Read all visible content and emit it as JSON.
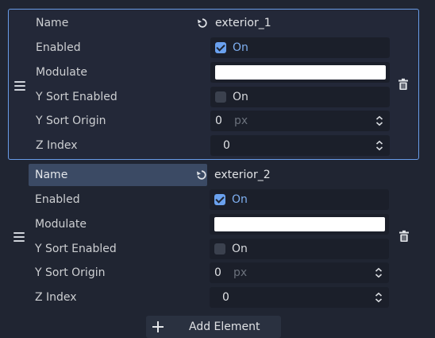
{
  "elements": [
    {
      "name_label": "Name",
      "name_value": "exterior_1",
      "enabled_label": "Enabled",
      "enabled_value": "On",
      "modulate_label": "Modulate",
      "modulate_color": "#ffffff",
      "ysort_enabled_label": "Y Sort Enabled",
      "ysort_enabled_value": "On",
      "ysort_origin_label": "Y Sort Origin",
      "ysort_origin_value": "0",
      "ysort_origin_suffix": "px",
      "zindex_label": "Z Index",
      "zindex_value": "0"
    },
    {
      "name_label": "Name",
      "name_value": "exterior_2",
      "enabled_label": "Enabled",
      "enabled_value": "On",
      "modulate_label": "Modulate",
      "modulate_color": "#ffffff",
      "ysort_enabled_label": "Y Sort Enabled",
      "ysort_enabled_value": "On",
      "ysort_origin_label": "Y Sort Origin",
      "ysort_origin_value": "0",
      "ysort_origin_suffix": "px",
      "zindex_label": "Z Index",
      "zindex_value": "0"
    }
  ],
  "add_button_label": "Add Element",
  "icons": {
    "drag": "drag-handle-icon",
    "trash": "trash-icon",
    "revert": "revert-icon",
    "spin": "spinbox-arrows-icon",
    "add": "plus-icon"
  },
  "colors": {
    "accent": "#699ce8",
    "checkbox_on": "#6aa1ee",
    "background": "#202532",
    "field": "#1b1f2a"
  }
}
